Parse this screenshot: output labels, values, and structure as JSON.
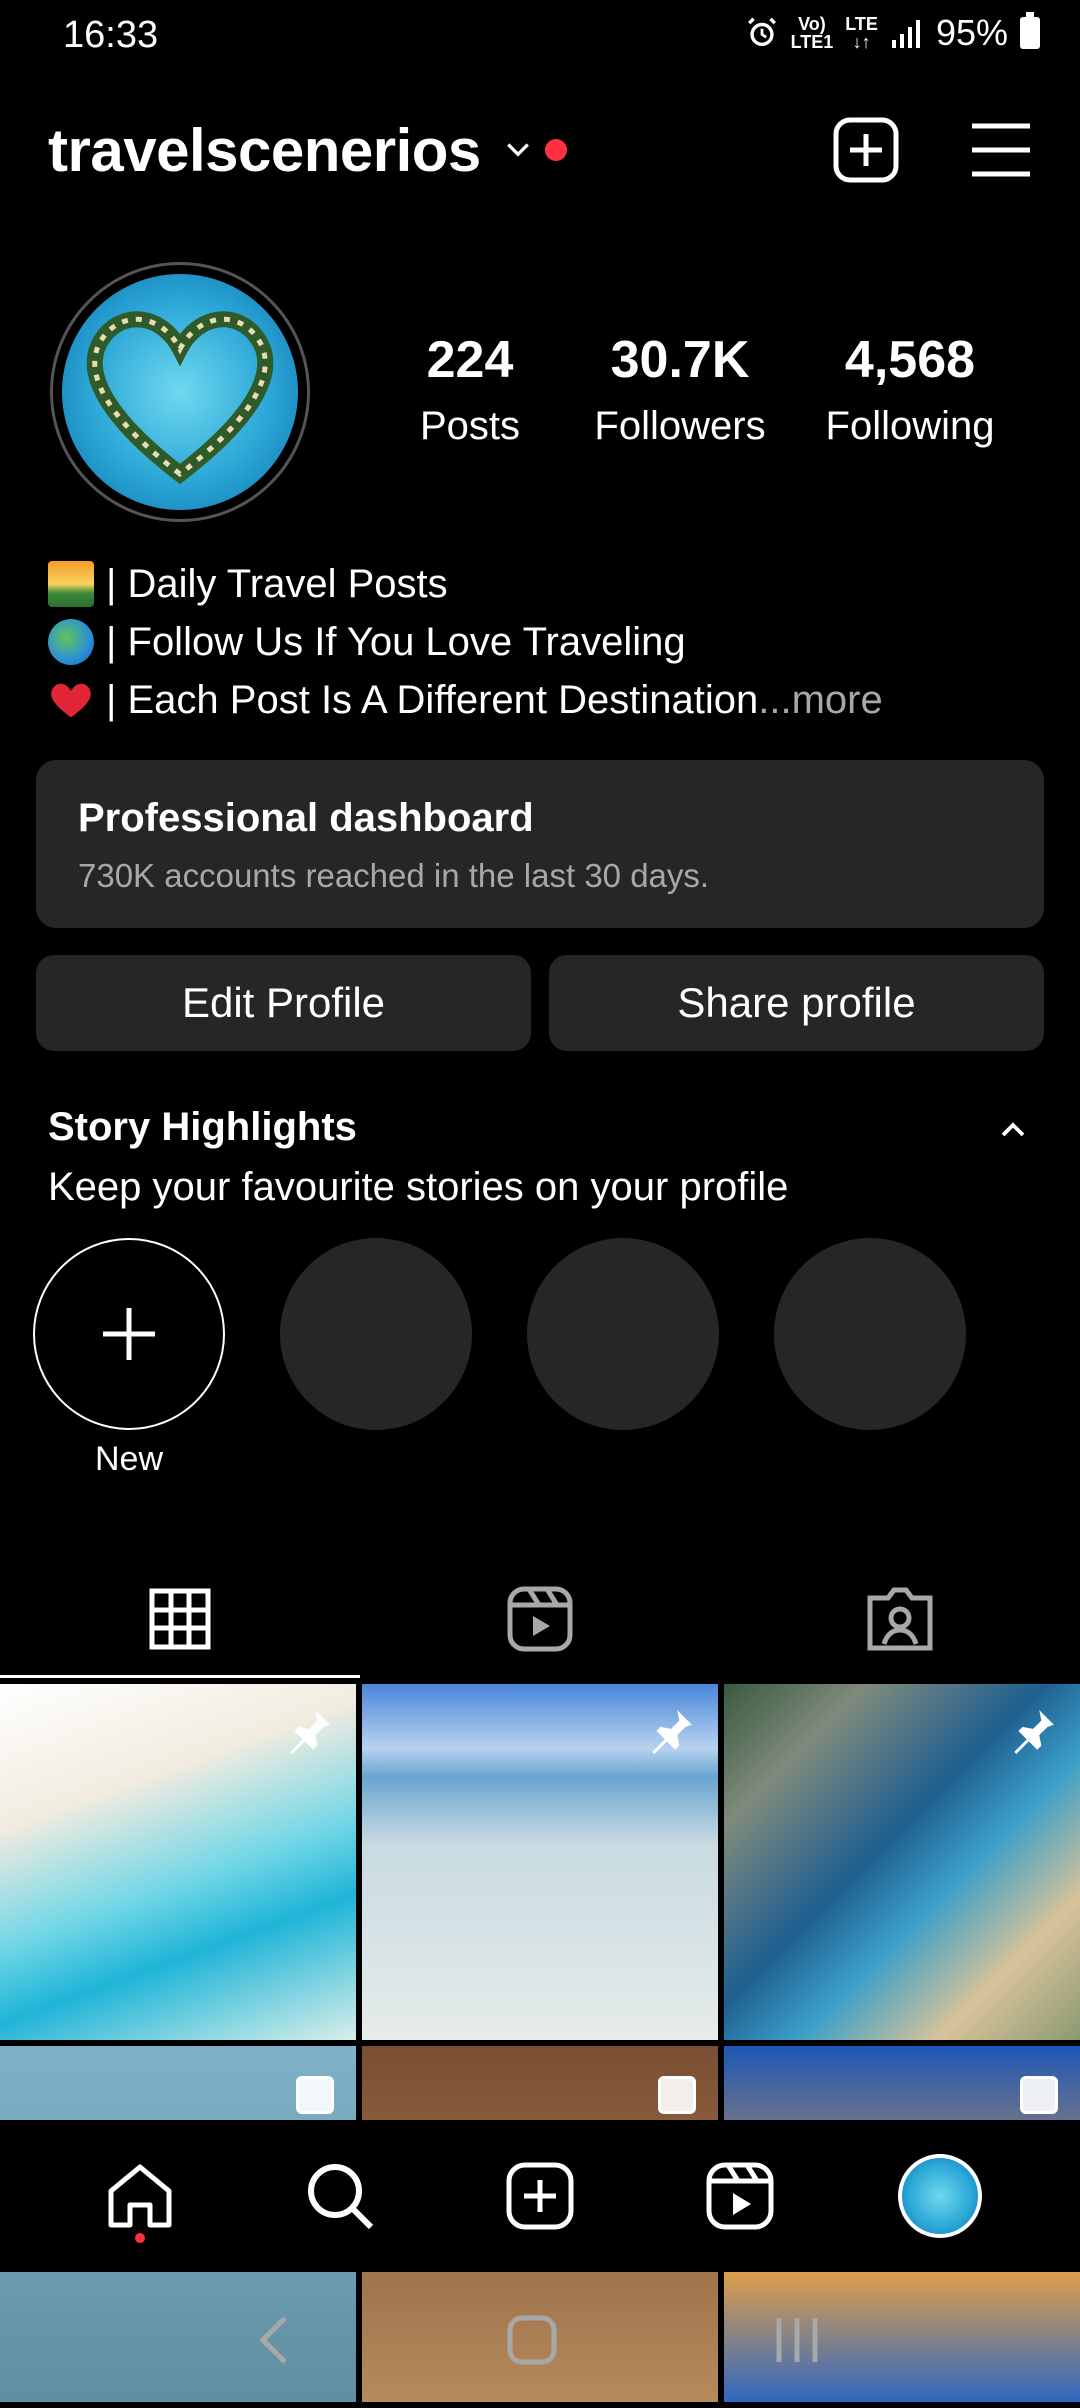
{
  "status_bar": {
    "time": "16:33",
    "network_top": "Vo)",
    "network_bottom": "LTE1",
    "lte_label": "LTE",
    "battery": "95%"
  },
  "header": {
    "username": "travelscenerios",
    "notification_dot_color": "#ff3040"
  },
  "profile": {
    "stats": [
      {
        "value": "224",
        "label": "Posts"
      },
      {
        "value": "30.7K",
        "label": "Followers"
      },
      {
        "value": "4,568",
        "label": "Following"
      }
    ],
    "bio": {
      "line1": "| Daily Travel Posts",
      "line2": "| Follow Us If You Love Traveling",
      "line3": "| Each Post Is A Different Destination",
      "ellipsis": "...",
      "more": " more"
    }
  },
  "dashboard": {
    "title": "Professional dashboard",
    "subtitle": "730K accounts reached in the last 30 days."
  },
  "buttons": {
    "edit": "Edit Profile",
    "share": "Share profile"
  },
  "highlights": {
    "title": "Story Highlights",
    "subtitle": "Keep your favourite stories on your profile",
    "new_label": "New"
  },
  "tabs": [
    "grid-icon",
    "reels-icon",
    "tagged-icon"
  ],
  "grid_posts": [
    {
      "pinned": true,
      "icon": "pin-icon"
    },
    {
      "pinned": true,
      "icon": "pin-icon"
    },
    {
      "pinned": true,
      "icon": "pin-icon"
    },
    {
      "pinned": false,
      "icon": "carousel-icon"
    },
    {
      "pinned": false,
      "icon": "carousel-icon"
    },
    {
      "pinned": false,
      "icon": "carousel-icon"
    }
  ],
  "bottom_nav": [
    "home-icon",
    "search-icon",
    "create-icon",
    "reels-icon",
    "profile-avatar"
  ],
  "colors": {
    "background": "#000000",
    "surface": "#262626",
    "secondary_text": "#a8a8a8",
    "accent_red": "#ff3040"
  }
}
